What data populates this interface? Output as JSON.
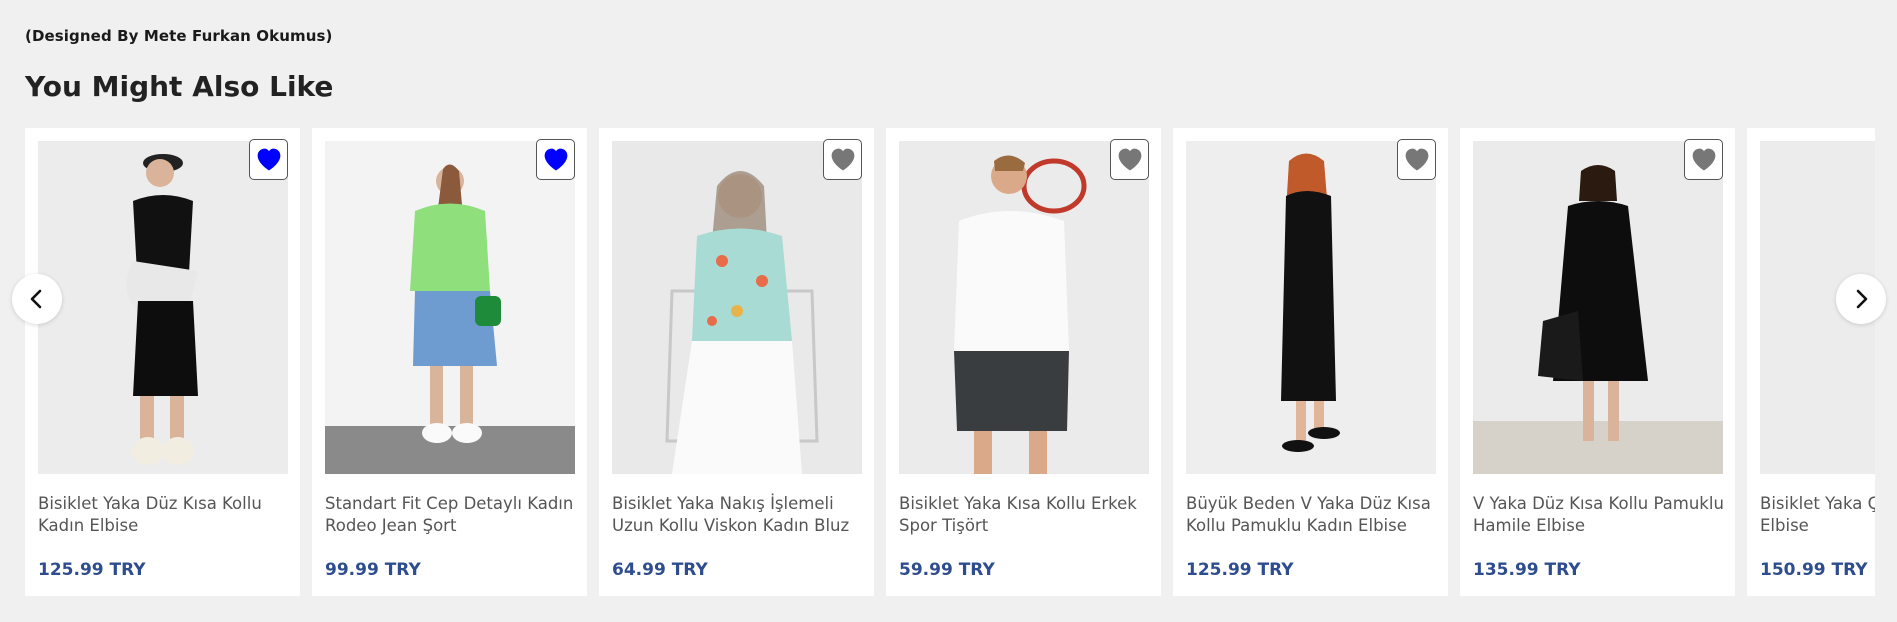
{
  "designer_note": "(Designed By Mete Furkan Okumus)",
  "section_title": "You Might Also Like",
  "nav": {
    "prev_icon": "chevron-left-icon",
    "next_icon": "chevron-right-icon"
  },
  "colors": {
    "price": "#2e4d8f",
    "heart_active": "#0000ff",
    "heart_inactive": "#777777",
    "background": "#f0f0f0"
  },
  "products": [
    {
      "name": "Bisiklet Yaka Düz Kısa Kollu Kadın Elbise",
      "price": "125.99 TRY",
      "favorited": true
    },
    {
      "name": "Standart Fit Cep Detaylı Kadın Rodeo Jean Şort",
      "price": "99.99 TRY",
      "favorited": true
    },
    {
      "name": "Bisiklet Yaka Nakış İşlemeli Uzun Kollu Viskon Kadın Bluz",
      "price": "64.99 TRY",
      "favorited": false
    },
    {
      "name": "Bisiklet Yaka Kısa Kollu Erkek Spor Tişört",
      "price": "59.99 TRY",
      "favorited": false
    },
    {
      "name": "Büyük Beden V Yaka Düz Kısa Kollu Pamuklu Kadın Elbise",
      "price": "125.99 TRY",
      "favorited": false
    },
    {
      "name": "V Yaka Düz Kısa Kollu Pamuklu Hamile Elbise",
      "price": "135.99 TRY",
      "favorited": false
    },
    {
      "name": "Bisiklet Yaka Çizgili Kadın Elbise",
      "price": "150.99 TRY",
      "favorited": false
    }
  ]
}
